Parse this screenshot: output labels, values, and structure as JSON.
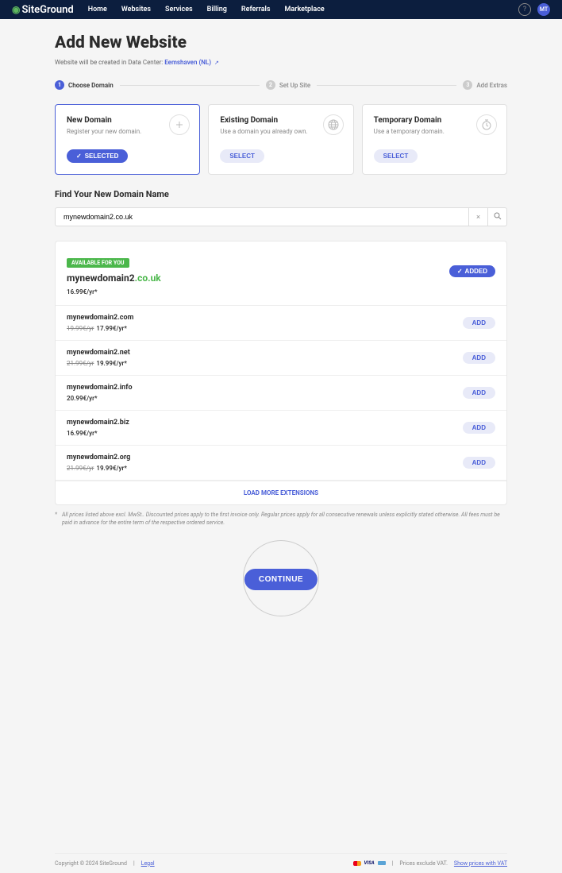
{
  "nav": {
    "logo": "SiteGround",
    "links": [
      "Home",
      "Websites",
      "Services",
      "Billing",
      "Referrals",
      "Marketplace"
    ],
    "avatar": "MT"
  },
  "page": {
    "title": "Add New Website",
    "subtitle_prefix": "Website will be created in Data Center: ",
    "datacenter": "Eemshaven (NL)"
  },
  "steps": [
    {
      "num": "1",
      "label": "Choose Domain",
      "active": true
    },
    {
      "num": "2",
      "label": "Set Up Site",
      "active": false
    },
    {
      "num": "3",
      "label": "Add Extras",
      "active": false
    }
  ],
  "options": [
    {
      "title": "New Domain",
      "desc": "Register your new domain.",
      "btn": "SELECTED",
      "selected": true
    },
    {
      "title": "Existing Domain",
      "desc": "Use a domain you already own.",
      "btn": "SELECT",
      "selected": false
    },
    {
      "title": "Temporary Domain",
      "desc": "Use a temporary domain.",
      "btn": "SELECT",
      "selected": false
    }
  ],
  "search": {
    "title": "Find Your New Domain Name",
    "value": "mynewdomain2.co.uk"
  },
  "main_result": {
    "badge": "AVAILABLE FOR YOU",
    "name": "mynewdomain2",
    "tld": ".co.uk",
    "price": "16.99€/yr*",
    "btn": "ADDED"
  },
  "extensions": [
    {
      "domain": "mynewdomain2.com",
      "old_price": "19.99€/yr",
      "price": "17.99€/yr*",
      "btn": "ADD"
    },
    {
      "domain": "mynewdomain2.net",
      "old_price": "21.99€/yr",
      "price": "19.99€/yr*",
      "btn": "ADD"
    },
    {
      "domain": "mynewdomain2.info",
      "old_price": "",
      "price": "20.99€/yr*",
      "btn": "ADD"
    },
    {
      "domain": "mynewdomain2.biz",
      "old_price": "",
      "price": "16.99€/yr*",
      "btn": "ADD"
    },
    {
      "domain": "mynewdomain2.org",
      "old_price": "21.99€/yr",
      "price": "19.99€/yr*",
      "btn": "ADD"
    }
  ],
  "load_more": "LOAD MORE EXTENSIONS",
  "disclaimer": "All prices listed above excl. MwSt.. Discounted prices apply to the first invoice only. Regular prices apply for all consecutive renewals unless explicitly stated otherwise. All fees must be paid in advance for the entire term of the respective ordered service.",
  "continue": "CONTINUE",
  "footer": {
    "copyright": "Copyright © 2024 SiteGround",
    "legal": "Legal",
    "vat": "Prices exclude VAT.",
    "vat_link": "Show prices with VAT"
  }
}
